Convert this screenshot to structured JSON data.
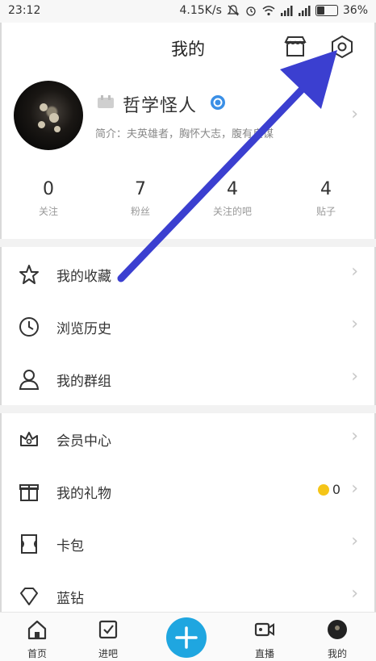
{
  "status_bar": {
    "time": "23:12",
    "network_speed": "4.15K/s",
    "battery": "36%",
    "battery_level": 0.36
  },
  "header": {
    "title": "我的",
    "store_icon": "store-icon",
    "settings_icon": "hexagon-settings-icon"
  },
  "profile": {
    "username": "哲学怪人",
    "bio": "简介：夫英雄者，胸怀大志，腹有良谋"
  },
  "stats": [
    {
      "num": "0",
      "label": "关注"
    },
    {
      "num": "7",
      "label": "粉丝"
    },
    {
      "num": "4",
      "label": "关注的吧"
    },
    {
      "num": "4",
      "label": "贴子"
    }
  ],
  "menu": {
    "group1": [
      {
        "label": "我的收藏",
        "icon": "star-icon"
      },
      {
        "label": "浏览历史",
        "icon": "clock-icon"
      },
      {
        "label": "我的群组",
        "icon": "group-icon"
      }
    ],
    "group2": [
      {
        "label": "会员中心",
        "icon": "crown-icon"
      },
      {
        "label": "我的礼物",
        "icon": "gift-icon",
        "extra": "0"
      },
      {
        "label": "卡包",
        "icon": "card-icon"
      },
      {
        "label": "蓝钻",
        "icon": "diamond-icon"
      }
    ]
  },
  "bottom_nav": [
    {
      "label": "首页",
      "icon": "home-icon"
    },
    {
      "label": "进吧",
      "icon": "checkbox-icon"
    },
    {
      "label": "",
      "icon": "plus-icon"
    },
    {
      "label": "直播",
      "icon": "video-icon"
    },
    {
      "label": "我的",
      "icon": "avatar-icon"
    }
  ],
  "colors": {
    "accent": "#1fa6e0",
    "annotation_arrow": "#3b3fd0",
    "coin": "#f5c518",
    "verified": "#3a8fe6"
  }
}
